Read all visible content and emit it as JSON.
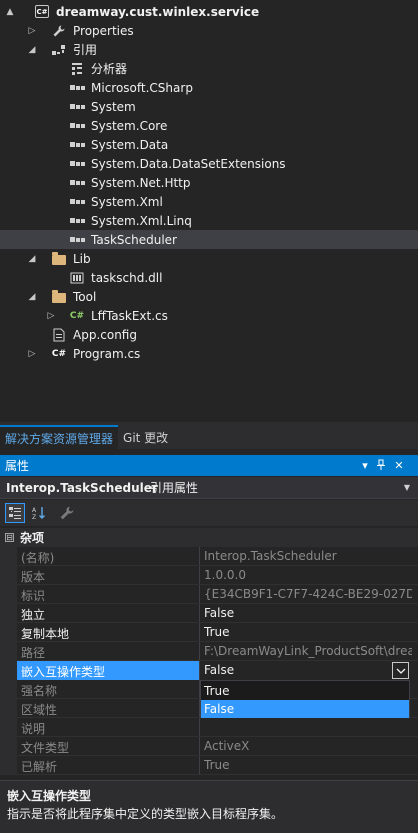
{
  "tree": {
    "items": [
      {
        "label": "dreamway.cust.winlex.service",
        "icon": "csharp-project-icon",
        "expander": "▲",
        "bold": true
      },
      {
        "label": "Properties",
        "icon": "wrench-icon",
        "expander": "▷"
      },
      {
        "label": "引用",
        "icon": "references-icon",
        "expander": "◢"
      },
      {
        "label": "分析器",
        "icon": "analyzer-icon"
      },
      {
        "label": "Microsoft.CSharp",
        "icon": "reference-icon"
      },
      {
        "label": "System",
        "icon": "reference-icon"
      },
      {
        "label": "System.Core",
        "icon": "reference-icon"
      },
      {
        "label": "System.Data",
        "icon": "reference-icon"
      },
      {
        "label": "System.Data.DataSetExtensions",
        "icon": "reference-icon"
      },
      {
        "label": "System.Net.Http",
        "icon": "reference-icon"
      },
      {
        "label": "System.Xml",
        "icon": "reference-icon"
      },
      {
        "label": "System.Xml.Linq",
        "icon": "reference-icon"
      },
      {
        "label": "TaskScheduler",
        "icon": "reference-icon",
        "selected": true
      },
      {
        "label": "Lib",
        "icon": "folder-icon",
        "expander": "◢"
      },
      {
        "label": "taskschd.dll",
        "icon": "dll-file-icon"
      },
      {
        "label": "Tool",
        "icon": "folder-icon",
        "expander": "◢"
      },
      {
        "label": "LffTaskExt.cs",
        "icon": "csharp-file-icon",
        "expander": "▷"
      },
      {
        "label": "App.config",
        "icon": "config-file-icon"
      },
      {
        "label": "Program.cs",
        "icon": "csharp-file-icon",
        "expander": "▷"
      }
    ]
  },
  "tabs": [
    {
      "label": "解决方案资源管理器",
      "active": true
    },
    {
      "label": "Git 更改",
      "active": false
    }
  ],
  "properties": {
    "title": "属性",
    "object_name": "Interop.TaskScheduler",
    "object_kind": "引用属性",
    "category_toggle": "⊟",
    "category": "杂项",
    "rows": [
      {
        "name": "(名称)",
        "value": "Interop.TaskScheduler",
        "readonly": true
      },
      {
        "name": "版本",
        "value": "1.0.0.0",
        "readonly": true
      },
      {
        "name": "标识",
        "value": "{E34CB9F1-C7F7-424C-BE29-027DC",
        "readonly": true
      },
      {
        "name": "独立",
        "value": "False",
        "readonly": false
      },
      {
        "name": "复制本地",
        "value": "True",
        "readonly": false
      },
      {
        "name": "路径",
        "value": "F:\\DreamWayLink_ProductSoft\\drea",
        "readonly": true
      },
      {
        "name": "嵌入互操作类型",
        "value": "False",
        "readonly": false,
        "selected": true
      },
      {
        "name": "强名称",
        "value": "",
        "readonly": true
      },
      {
        "name": "区域性",
        "value": "",
        "readonly": true
      },
      {
        "name": "说明",
        "value": "",
        "readonly": true
      },
      {
        "name": "文件类型",
        "value": "ActiveX",
        "readonly": true
      },
      {
        "name": "已解析",
        "value": "True",
        "readonly": true
      }
    ],
    "dropdown_options": [
      "True",
      "False"
    ],
    "dropdown_highlight": 1,
    "description_title": "嵌入互操作类型",
    "description_text": "指示是否将此程序集中定义的类型嵌入目标程序集。"
  },
  "colors": {
    "accent": "#007acc",
    "selection": "#3399ff",
    "background": "#252526"
  }
}
